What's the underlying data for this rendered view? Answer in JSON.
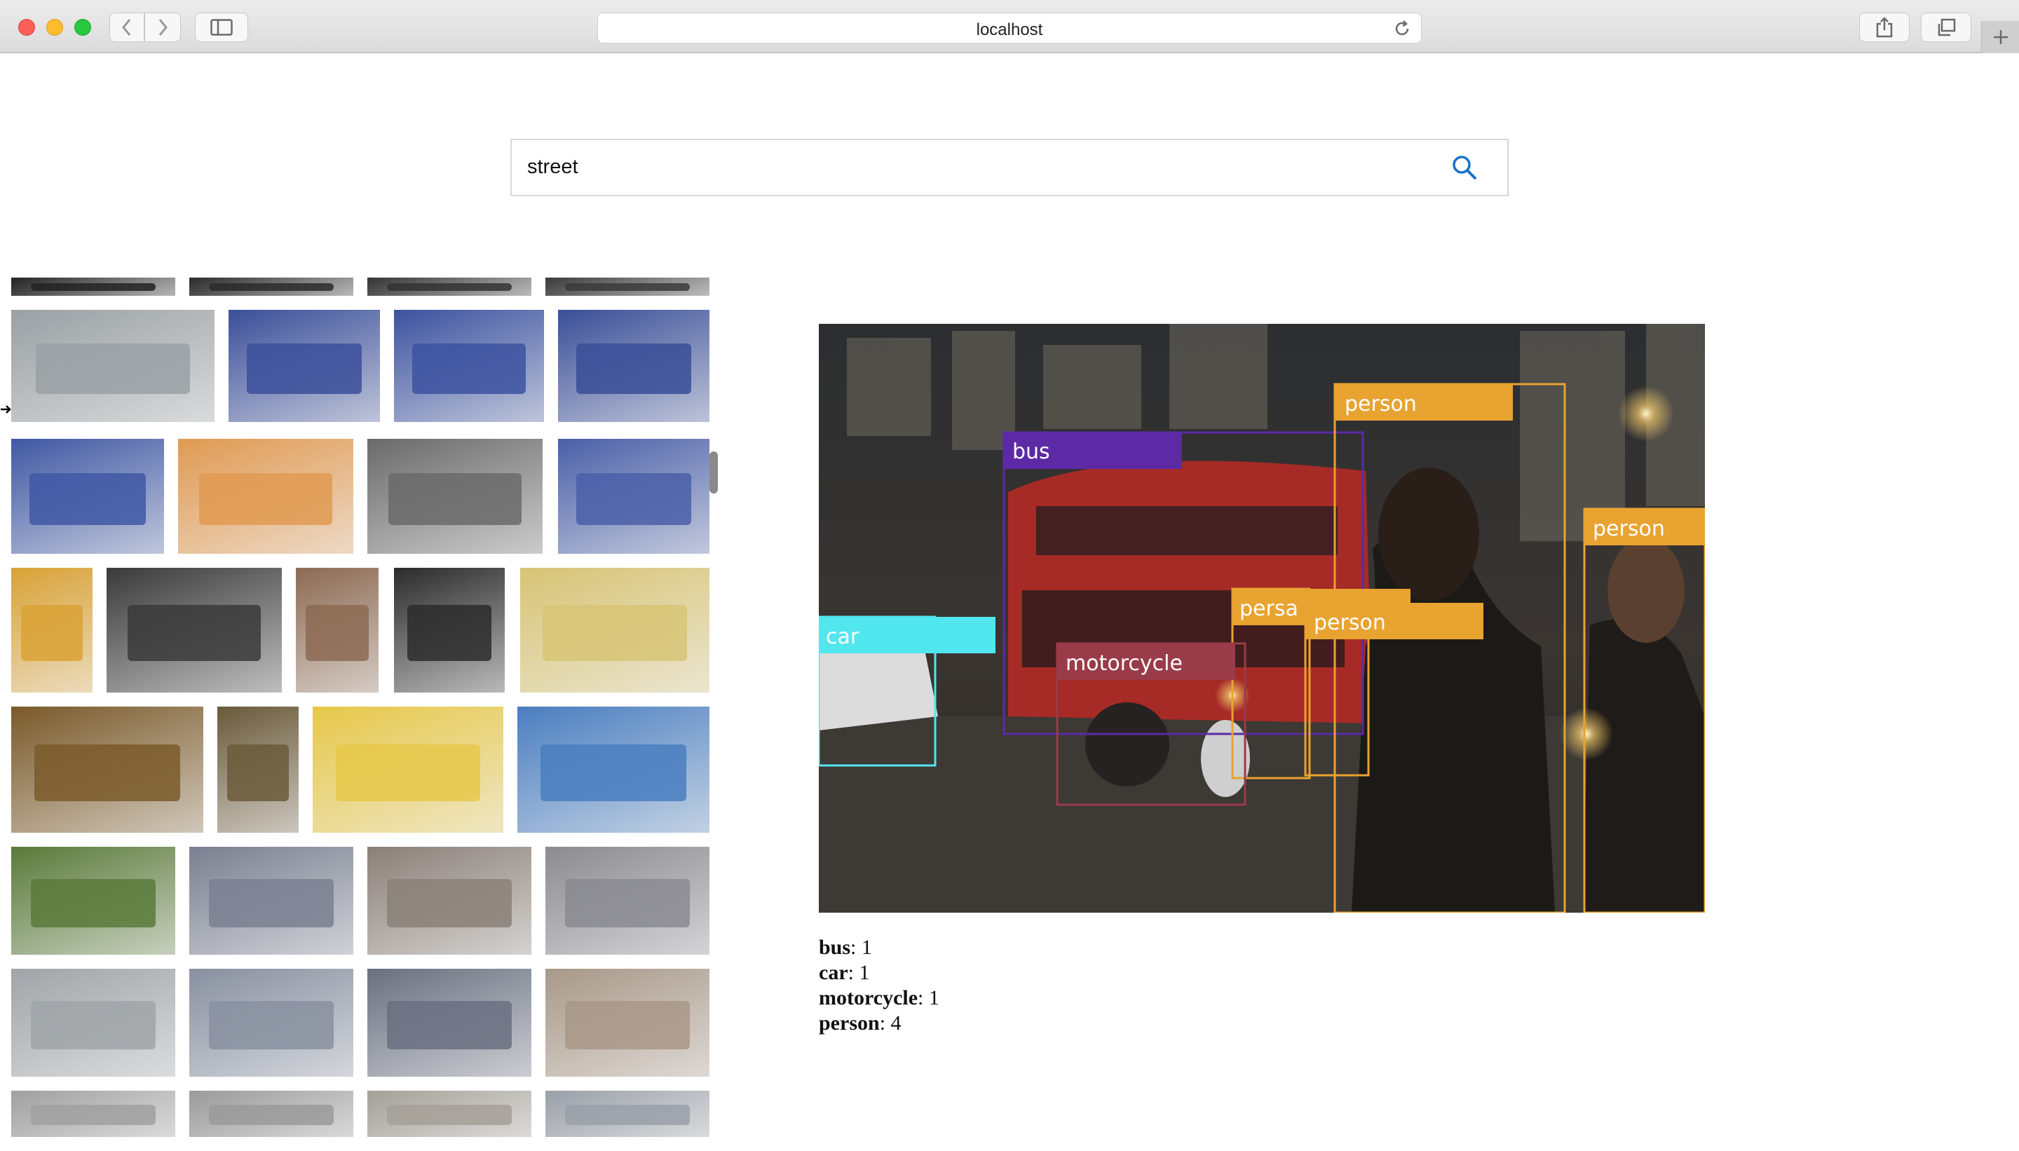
{
  "browser": {
    "url": "localhost"
  },
  "search": {
    "query": "street"
  },
  "result": {
    "detections": [
      {
        "label": "bus",
        "color": "#5c2aa5"
      },
      {
        "label": "person",
        "color": "#e8a330"
      },
      {
        "label": "person",
        "color": "#e8a330"
      },
      {
        "label": "persa",
        "color": "#e8a330"
      },
      {
        "label": "person",
        "color": "#e8a330"
      },
      {
        "label": "car",
        "color": "#52e6ee"
      },
      {
        "label": "motorcycle",
        "color": "#9a3b4a"
      }
    ],
    "counts": [
      {
        "label": "bus",
        "sep": ": ",
        "value": "1"
      },
      {
        "label": "car",
        "sep": ": ",
        "value": "1"
      },
      {
        "label": "motorcycle",
        "sep": ": ",
        "value": "1"
      },
      {
        "label": "person",
        "sep": ": ",
        "value": "4"
      }
    ]
  },
  "colors": {
    "search_icon": "#1a73c8",
    "bus_box": "#5c2aa5",
    "person_box": "#e8a330",
    "car_box": "#52e6ee",
    "motorcycle_box": "#9a3b4a"
  },
  "gallery": {
    "thumbnails": [
      {
        "name": "dark-street",
        "color": "#222222"
      },
      {
        "name": "dark-street",
        "color": "#2a2a2a"
      },
      {
        "name": "dark-street",
        "color": "#333333"
      },
      {
        "name": "dark-street",
        "color": "#3a3a3a"
      },
      {
        "name": "road-sign-bus",
        "color": "#9aa0a4"
      },
      {
        "name": "blue-bus",
        "color": "#3b4f9a"
      },
      {
        "name": "blue-bus",
        "color": "#3c52a0"
      },
      {
        "name": "blue-bus",
        "color": "#3a4e98"
      },
      {
        "name": "blue-bus",
        "color": "#4058a4"
      },
      {
        "name": "mailboxes",
        "color": "#e09a52"
      },
      {
        "name": "bird-sculpture",
        "color": "#6a6a6a"
      },
      {
        "name": "blue-bus",
        "color": "#4a5fa8"
      },
      {
        "name": "yellow-sculpture",
        "color": "#d9a236"
      },
      {
        "name": "tunnel-people",
        "color": "#3a3a3a"
      },
      {
        "name": "corner-building",
        "color": "#8c6a52"
      },
      {
        "name": "poster",
        "color": "#2b2b2b"
      },
      {
        "name": "yellow-tram",
        "color": "#d7c475"
      },
      {
        "name": "cafe-interior",
        "color": "#7a5a2a"
      },
      {
        "name": "gallery-arcade",
        "color": "#6a5a3a"
      },
      {
        "name": "yellow-tram-window",
        "color": "#e6c84a"
      },
      {
        "name": "plaza-people",
        "color": "#4a7ec0"
      },
      {
        "name": "temple-gate",
        "color": "#5a7a3a"
      },
      {
        "name": "double-decker",
        "color": "#7a8090"
      },
      {
        "name": "coach",
        "color": "#8a8078"
      },
      {
        "name": "double-decker",
        "color": "#8a8a90"
      },
      {
        "name": "single-bus",
        "color": "#a0a4a8"
      },
      {
        "name": "double-decker",
        "color": "#8890a0"
      },
      {
        "name": "bus-station",
        "color": "#6a7080"
      },
      {
        "name": "bus-building",
        "color": "#a89888"
      },
      {
        "name": "bus-row",
        "color": "#a0a0a0"
      },
      {
        "name": "bus-row",
        "color": "#9a9a9a"
      },
      {
        "name": "bus-row",
        "color": "#a4a098"
      },
      {
        "name": "bus-row",
        "color": "#9aa0a8"
      }
    ]
  }
}
